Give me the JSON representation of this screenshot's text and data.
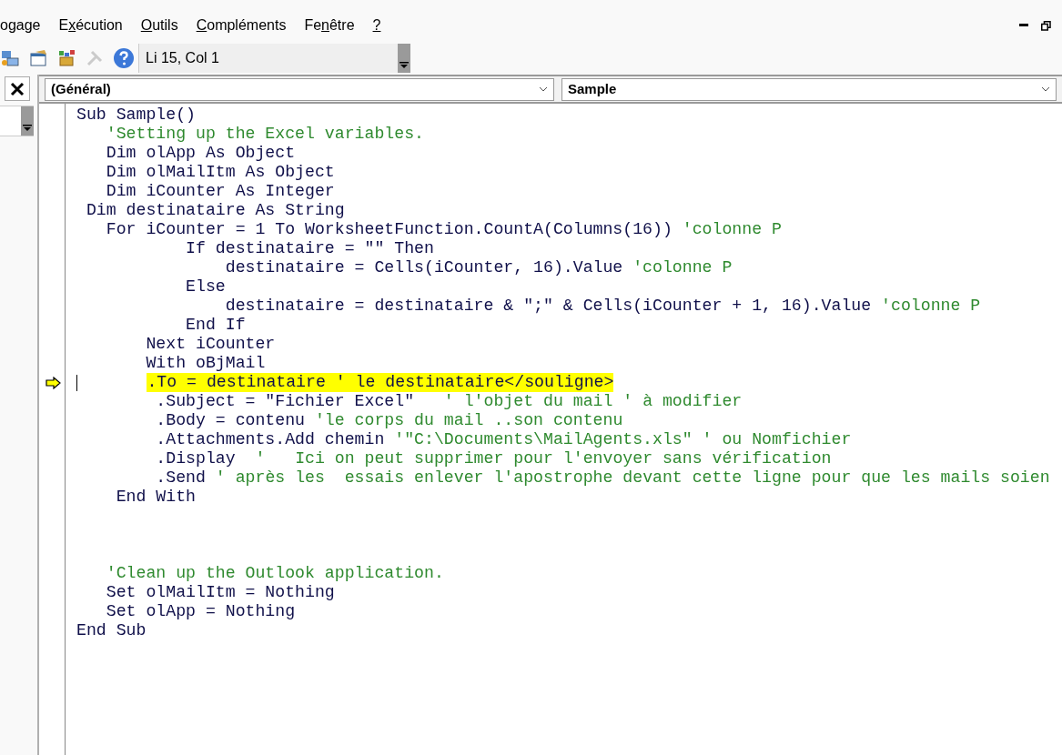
{
  "menu": [
    {
      "pre": "ogage"
    },
    {
      "pre": "E",
      "key": "x",
      "post": "écution"
    },
    {
      "key": "O",
      "post": "utils"
    },
    {
      "key": "C",
      "post": "ompléments"
    },
    {
      "pre": "Fe",
      "key": "n",
      "post": "être"
    },
    {
      "key": "?"
    }
  ],
  "toolbar": {
    "tools": [
      {
        "kind": "explorer",
        "disabled": false
      },
      {
        "kind": "properties",
        "disabled": false
      },
      {
        "kind": "browser",
        "disabled": false
      },
      {
        "kind": "toolbox",
        "disabled": true
      },
      {
        "kind": "help",
        "disabled": false
      }
    ],
    "position": "Li 15, Col 1"
  },
  "code_window": {
    "object_combo": "(Général)",
    "procedure_combo": "Sample",
    "lines": [
      {
        "segments": [
          {
            "kind": "code",
            "text": "Sub Sample()"
          }
        ]
      },
      {
        "segments": [
          {
            "kind": "comment",
            "text": "   'Setting up the Excel variables."
          }
        ]
      },
      {
        "segments": [
          {
            "kind": "code",
            "text": "   Dim olApp As Object"
          }
        ]
      },
      {
        "segments": [
          {
            "kind": "code",
            "text": "   Dim olMailItm As Object"
          }
        ]
      },
      {
        "segments": [
          {
            "kind": "code",
            "text": "   Dim iCounter As Integer"
          }
        ]
      },
      {
        "segments": [
          {
            "kind": "code",
            "text": " Dim destinataire As String"
          }
        ]
      },
      {
        "segments": [
          {
            "kind": "code",
            "text": "   For iCounter = 1 To WorksheetFunction.CountA(Columns(16)) "
          },
          {
            "kind": "comment",
            "text": "'colonne P"
          }
        ]
      },
      {
        "segments": [
          {
            "kind": "code",
            "text": "           If destinataire = \"\" Then"
          }
        ]
      },
      {
        "segments": [
          {
            "kind": "code",
            "text": "               destinataire = Cells(iCounter, 16).Value "
          },
          {
            "kind": "comment",
            "text": "'colonne P"
          }
        ]
      },
      {
        "segments": [
          {
            "kind": "code",
            "text": "           Else"
          }
        ]
      },
      {
        "segments": [
          {
            "kind": "code",
            "text": "               destinataire = destinataire & \";\" & Cells(iCounter + 1, 16).Value "
          },
          {
            "kind": "comment",
            "text": "'colonne P"
          }
        ]
      },
      {
        "segments": [
          {
            "kind": "code",
            "text": "           End If"
          }
        ]
      },
      {
        "segments": [
          {
            "kind": "code",
            "text": "       Next iCounter"
          }
        ]
      },
      {
        "segments": [
          {
            "kind": "code",
            "text": "       With oBjMail"
          }
        ]
      },
      {
        "current": true,
        "segments": [
          {
            "kind": "code",
            "text": "        .To = destinataire ' le destinataire</souligne>"
          }
        ]
      },
      {
        "segments": [
          {
            "kind": "code",
            "text": "        .Subject = \"Fichier Excel\"   "
          },
          {
            "kind": "comment",
            "text": "' l'objet du mail ' à modifier"
          }
        ]
      },
      {
        "segments": [
          {
            "kind": "code",
            "text": "        .Body = contenu "
          },
          {
            "kind": "comment",
            "text": "'le corps du mail ..son contenu"
          }
        ]
      },
      {
        "segments": [
          {
            "kind": "code",
            "text": "        .Attachments.Add chemin "
          },
          {
            "kind": "comment",
            "text": "'\"C:\\Documents\\MailAgents.xls\" ' ou Nomfichier"
          }
        ]
      },
      {
        "segments": [
          {
            "kind": "code",
            "text": "        .Display  "
          },
          {
            "kind": "comment",
            "text": "'   Ici on peut supprimer pour l'envoyer sans vérification"
          }
        ]
      },
      {
        "segments": [
          {
            "kind": "code",
            "text": "        .Send "
          },
          {
            "kind": "comment",
            "text": "' après les  essais enlever l'apostrophe devant cette ligne pour que les mails soien"
          }
        ]
      },
      {
        "segments": [
          {
            "kind": "code",
            "text": "    End With"
          }
        ]
      },
      {
        "kind": "blank"
      },
      {
        "kind": "blank"
      },
      {
        "kind": "blank"
      },
      {
        "segments": [
          {
            "kind": "comment",
            "text": "   'Clean up the Outlook application."
          }
        ]
      },
      {
        "segments": [
          {
            "kind": "code",
            "text": "   Set olMailItm = Nothing"
          }
        ]
      },
      {
        "segments": [
          {
            "kind": "code",
            "text": "   Set olApp = Nothing"
          }
        ]
      },
      {
        "segments": [
          {
            "kind": "code",
            "text": "End Sub"
          }
        ]
      }
    ]
  }
}
